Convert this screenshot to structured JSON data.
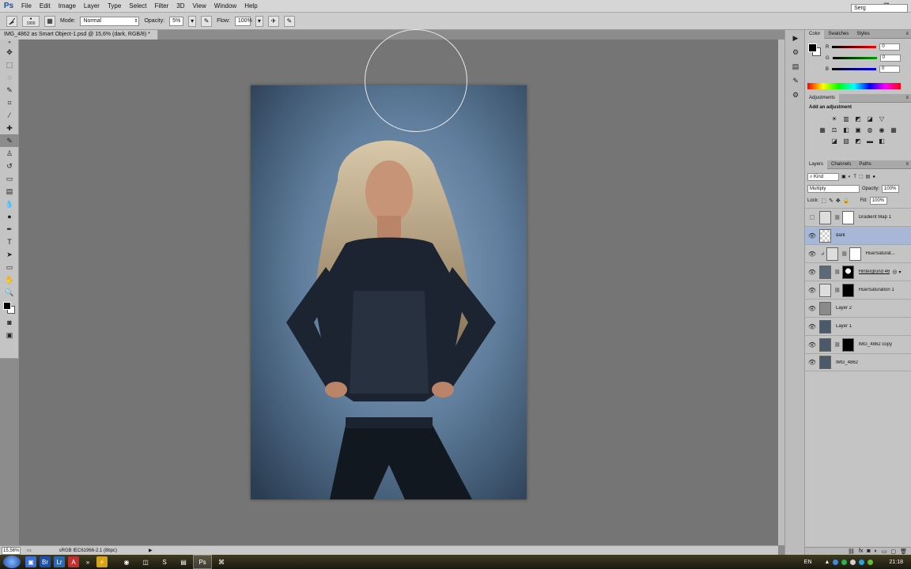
{
  "app": {
    "logo": "Ps"
  },
  "menu": [
    "File",
    "Edit",
    "Image",
    "Layer",
    "Type",
    "Select",
    "Filter",
    "3D",
    "View",
    "Window",
    "Help"
  ],
  "window_controls": [
    "_",
    "❐",
    "✕"
  ],
  "options_bar": {
    "brush_size": "1900",
    "mode_label": "Mode:",
    "mode_value": "Normal",
    "opacity_label": "Opacity:",
    "opacity_value": "5%",
    "flow_label": "Flow:",
    "flow_value": "100%",
    "user": "Serg"
  },
  "document_tab": {
    "title": "IMG_4862 as Smart Object-1.psd @ 15,6% (dark, RGB/8) *",
    "close": "×"
  },
  "status_bar": {
    "zoom": "15,56%",
    "doc_info": "sRGB IEC61966-2.1 (8bpc)"
  },
  "color_panel": {
    "tabs": [
      "Color",
      "Swatches",
      "Styles"
    ],
    "channels": [
      {
        "label": "R",
        "value": "0",
        "track": "#ff0000"
      },
      {
        "label": "G",
        "value": "0",
        "track": "#00a000"
      },
      {
        "label": "B",
        "value": "0",
        "track": "#0000ff"
      }
    ]
  },
  "adjustments_panel": {
    "tab": "Adjustments",
    "title": "Add an adjustment"
  },
  "layers_panel": {
    "tabs": [
      "Layers",
      "Channels",
      "Paths"
    ],
    "filter": "Kind",
    "blend_mode": "Multiply",
    "opacity_label": "Opacity:",
    "opacity_value": "100%",
    "lock_label": "Lock:",
    "fill_label": "Fill:",
    "fill_value": "100%",
    "layers": [
      {
        "name": "Gradient Map 1",
        "visible": false,
        "selected": false
      },
      {
        "name": "dark",
        "visible": true,
        "selected": true
      },
      {
        "name": "Hue/Saturat...",
        "visible": true,
        "selected": false
      },
      {
        "name": "Hintergrund 46",
        "visible": true,
        "selected": false
      },
      {
        "name": "Hue/Saturation 1",
        "visible": true,
        "selected": false
      },
      {
        "name": "Layer 2",
        "visible": true,
        "selected": false
      },
      {
        "name": "Layer 1",
        "visible": true,
        "selected": false
      },
      {
        "name": "IMG_4862 copy",
        "visible": true,
        "selected": false
      },
      {
        "name": "IMG_4862",
        "visible": true,
        "selected": false
      }
    ]
  },
  "taskbar": {
    "language": "EN",
    "time": "21:18"
  }
}
